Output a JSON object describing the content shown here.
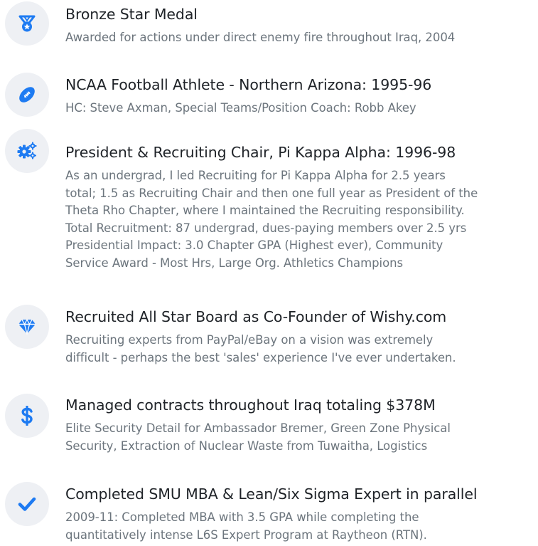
{
  "colors": {
    "icon_blue": "#1e7bf2",
    "icon_bg": "#eef0f4",
    "title": "#1f2328",
    "desc": "#6c757d"
  },
  "achievements": [
    {
      "icon": "medal-icon",
      "title": "Bronze Star Medal",
      "description": [
        "Awarded for actions under direct enemy fire throughout Iraq, 2004"
      ]
    },
    {
      "icon": "football-icon",
      "title": "NCAA Football Athlete - Northern Arizona: 1995-96",
      "description": [
        "HC: Steve Axman, Special Teams/Position Coach: Robb Akey"
      ]
    },
    {
      "icon": "cogs-icon",
      "title": "President & Recruiting Chair, Pi Kappa Alpha: 1996-98",
      "description": [
        "As an undergrad, I led Recruiting for Pi Kappa Alpha for 2.5 years",
        "total; 1.5 as Recruiting Chair and then one full year as President of the",
        "Theta Rho Chapter, where I maintained the Recruiting responsibility.",
        "Total Recruitment: 87 undergrad, dues-paying members over 2.5 yrs",
        "Presidential Impact: 3.0 Chapter GPA (Highest ever), Community",
        "Service Award - Most Hrs, Large Org. Athletics Champions"
      ]
    },
    {
      "icon": "diamond-icon",
      "title": "Recruited All Star Board as Co-Founder of Wishy.com",
      "description": [
        "Recruiting experts from PayPal/eBay on a vision was extremely",
        "difficult - perhaps the best 'sales' experience I've ever undertaken."
      ]
    },
    {
      "icon": "dollar-icon",
      "title": "Managed contracts throughout Iraq totaling $378M",
      "description": [
        "Elite Security Detail for Ambassador Bremer, Green Zone Physical",
        "Security, Extraction of Nuclear Waste from Tuwaitha, Logistics"
      ]
    },
    {
      "icon": "check-icon",
      "title": "Completed SMU MBA & Lean/Six Sigma Expert in parallel",
      "description": [
        "2009-11: Completed MBA with 3.5 GPA while completing the",
        "quantitatively intense L6S Expert Program at Raytheon (RTN)."
      ]
    }
  ]
}
